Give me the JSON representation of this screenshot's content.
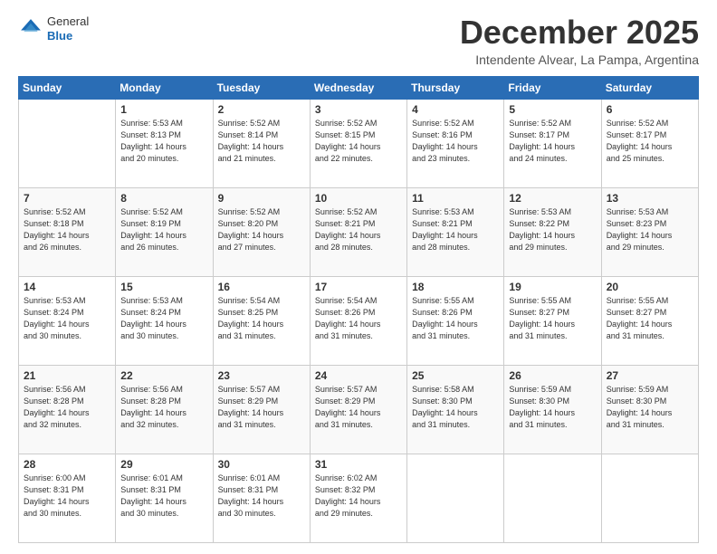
{
  "header": {
    "logo_line1": "General",
    "logo_line2": "Blue",
    "month": "December 2025",
    "location": "Intendente Alvear, La Pampa, Argentina"
  },
  "weekdays": [
    "Sunday",
    "Monday",
    "Tuesday",
    "Wednesday",
    "Thursday",
    "Friday",
    "Saturday"
  ],
  "weeks": [
    [
      {
        "day": "",
        "info": ""
      },
      {
        "day": "1",
        "info": "Sunrise: 5:53 AM\nSunset: 8:13 PM\nDaylight: 14 hours\nand 20 minutes."
      },
      {
        "day": "2",
        "info": "Sunrise: 5:52 AM\nSunset: 8:14 PM\nDaylight: 14 hours\nand 21 minutes."
      },
      {
        "day": "3",
        "info": "Sunrise: 5:52 AM\nSunset: 8:15 PM\nDaylight: 14 hours\nand 22 minutes."
      },
      {
        "day": "4",
        "info": "Sunrise: 5:52 AM\nSunset: 8:16 PM\nDaylight: 14 hours\nand 23 minutes."
      },
      {
        "day": "5",
        "info": "Sunrise: 5:52 AM\nSunset: 8:17 PM\nDaylight: 14 hours\nand 24 minutes."
      },
      {
        "day": "6",
        "info": "Sunrise: 5:52 AM\nSunset: 8:17 PM\nDaylight: 14 hours\nand 25 minutes."
      }
    ],
    [
      {
        "day": "7",
        "info": "Sunrise: 5:52 AM\nSunset: 8:18 PM\nDaylight: 14 hours\nand 26 minutes."
      },
      {
        "day": "8",
        "info": "Sunrise: 5:52 AM\nSunset: 8:19 PM\nDaylight: 14 hours\nand 26 minutes."
      },
      {
        "day": "9",
        "info": "Sunrise: 5:52 AM\nSunset: 8:20 PM\nDaylight: 14 hours\nand 27 minutes."
      },
      {
        "day": "10",
        "info": "Sunrise: 5:52 AM\nSunset: 8:21 PM\nDaylight: 14 hours\nand 28 minutes."
      },
      {
        "day": "11",
        "info": "Sunrise: 5:53 AM\nSunset: 8:21 PM\nDaylight: 14 hours\nand 28 minutes."
      },
      {
        "day": "12",
        "info": "Sunrise: 5:53 AM\nSunset: 8:22 PM\nDaylight: 14 hours\nand 29 minutes."
      },
      {
        "day": "13",
        "info": "Sunrise: 5:53 AM\nSunset: 8:23 PM\nDaylight: 14 hours\nand 29 minutes."
      }
    ],
    [
      {
        "day": "14",
        "info": "Sunrise: 5:53 AM\nSunset: 8:24 PM\nDaylight: 14 hours\nand 30 minutes."
      },
      {
        "day": "15",
        "info": "Sunrise: 5:53 AM\nSunset: 8:24 PM\nDaylight: 14 hours\nand 30 minutes."
      },
      {
        "day": "16",
        "info": "Sunrise: 5:54 AM\nSunset: 8:25 PM\nDaylight: 14 hours\nand 31 minutes."
      },
      {
        "day": "17",
        "info": "Sunrise: 5:54 AM\nSunset: 8:26 PM\nDaylight: 14 hours\nand 31 minutes."
      },
      {
        "day": "18",
        "info": "Sunrise: 5:55 AM\nSunset: 8:26 PM\nDaylight: 14 hours\nand 31 minutes."
      },
      {
        "day": "19",
        "info": "Sunrise: 5:55 AM\nSunset: 8:27 PM\nDaylight: 14 hours\nand 31 minutes."
      },
      {
        "day": "20",
        "info": "Sunrise: 5:55 AM\nSunset: 8:27 PM\nDaylight: 14 hours\nand 31 minutes."
      }
    ],
    [
      {
        "day": "21",
        "info": "Sunrise: 5:56 AM\nSunset: 8:28 PM\nDaylight: 14 hours\nand 32 minutes."
      },
      {
        "day": "22",
        "info": "Sunrise: 5:56 AM\nSunset: 8:28 PM\nDaylight: 14 hours\nand 32 minutes."
      },
      {
        "day": "23",
        "info": "Sunrise: 5:57 AM\nSunset: 8:29 PM\nDaylight: 14 hours\nand 31 minutes."
      },
      {
        "day": "24",
        "info": "Sunrise: 5:57 AM\nSunset: 8:29 PM\nDaylight: 14 hours\nand 31 minutes."
      },
      {
        "day": "25",
        "info": "Sunrise: 5:58 AM\nSunset: 8:30 PM\nDaylight: 14 hours\nand 31 minutes."
      },
      {
        "day": "26",
        "info": "Sunrise: 5:59 AM\nSunset: 8:30 PM\nDaylight: 14 hours\nand 31 minutes."
      },
      {
        "day": "27",
        "info": "Sunrise: 5:59 AM\nSunset: 8:30 PM\nDaylight: 14 hours\nand 31 minutes."
      }
    ],
    [
      {
        "day": "28",
        "info": "Sunrise: 6:00 AM\nSunset: 8:31 PM\nDaylight: 14 hours\nand 30 minutes."
      },
      {
        "day": "29",
        "info": "Sunrise: 6:01 AM\nSunset: 8:31 PM\nDaylight: 14 hours\nand 30 minutes."
      },
      {
        "day": "30",
        "info": "Sunrise: 6:01 AM\nSunset: 8:31 PM\nDaylight: 14 hours\nand 30 minutes."
      },
      {
        "day": "31",
        "info": "Sunrise: 6:02 AM\nSunset: 8:32 PM\nDaylight: 14 hours\nand 29 minutes."
      },
      {
        "day": "",
        "info": ""
      },
      {
        "day": "",
        "info": ""
      },
      {
        "day": "",
        "info": ""
      }
    ]
  ]
}
